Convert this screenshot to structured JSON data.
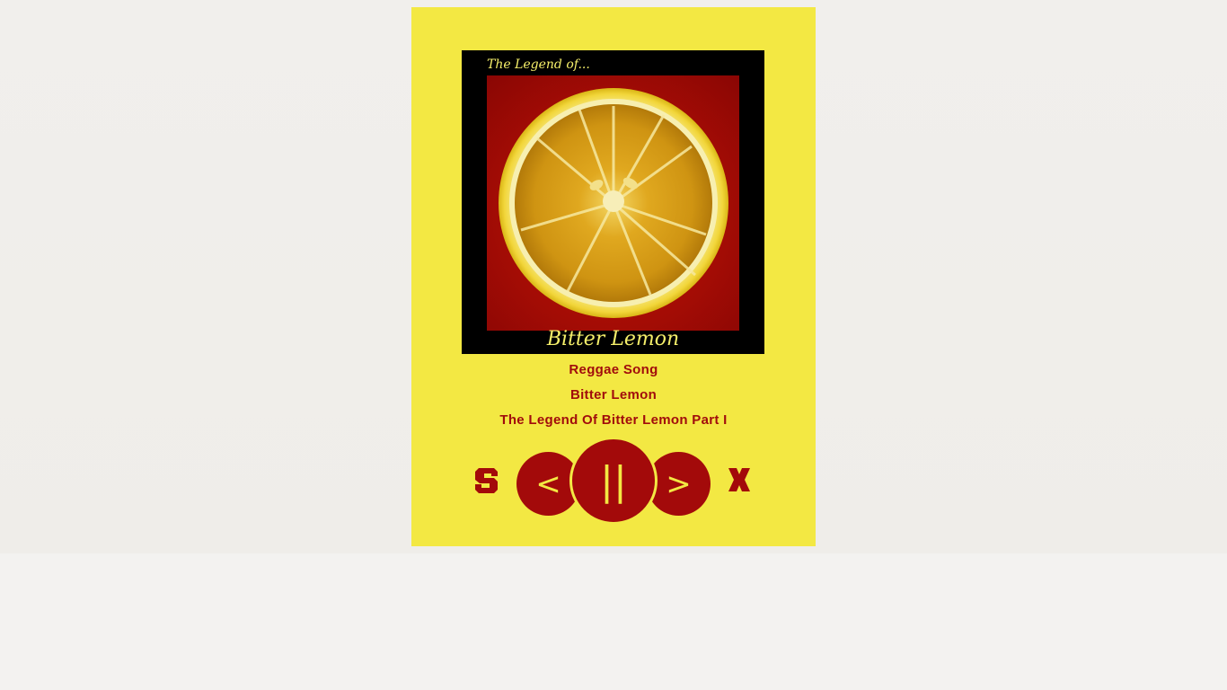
{
  "track": {
    "genre": "Reggae Song",
    "title": "Bitter Lemon",
    "album": "The Legend Of Bitter Lemon Part I"
  },
  "cover": {
    "top_text": "The Legend of...",
    "bottom_text": "Bitter Lemon"
  },
  "controls": {
    "prev_label": "<",
    "play_pause_label": "||",
    "next_label": ">",
    "repeat_icon": "repeat-icon",
    "shuffle_icon": "shuffle-icon"
  },
  "colors": {
    "panel": "#f3e843",
    "accent": "#a30a0a",
    "background": "#f1efec"
  }
}
